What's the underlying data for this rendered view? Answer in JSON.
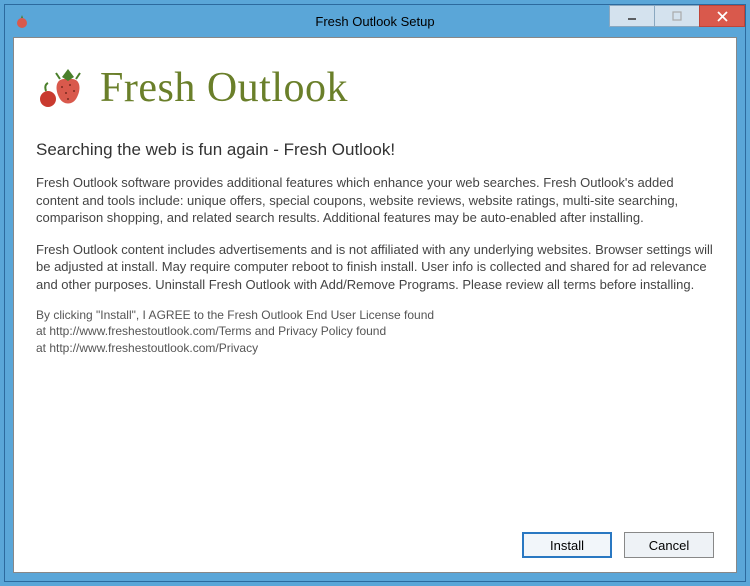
{
  "window": {
    "title": "Fresh Outlook Setup"
  },
  "logo": {
    "text": "Fresh Outlook"
  },
  "headline": "Searching the web is fun again - Fresh Outlook!",
  "paragraph1": "Fresh Outlook software provides additional features which enhance your web searches. Fresh Outlook's added content and tools include: unique offers, special coupons, website reviews, website ratings, multi-site searching, comparison shopping, and related search results. Additional features may be auto-enabled after installing.",
  "paragraph2": "Fresh Outlook content includes advertisements and is not affiliated with any underlying websites. Browser settings will be adjusted at install. May require computer reboot to finish install. User info is collected and shared for ad relevance and other purposes. Uninstall Fresh Outlook with Add/Remove Programs. Please review all terms before installing.",
  "fineprint_line1": "By clicking \"Install\", I AGREE to the Fresh Outlook End User License found",
  "fineprint_line2": "at http://www.freshestoutlook.com/Terms and Privacy Policy found",
  "fineprint_line3": "at http://www.freshestoutlook.com/Privacy",
  "buttons": {
    "install": "Install",
    "cancel": "Cancel"
  }
}
